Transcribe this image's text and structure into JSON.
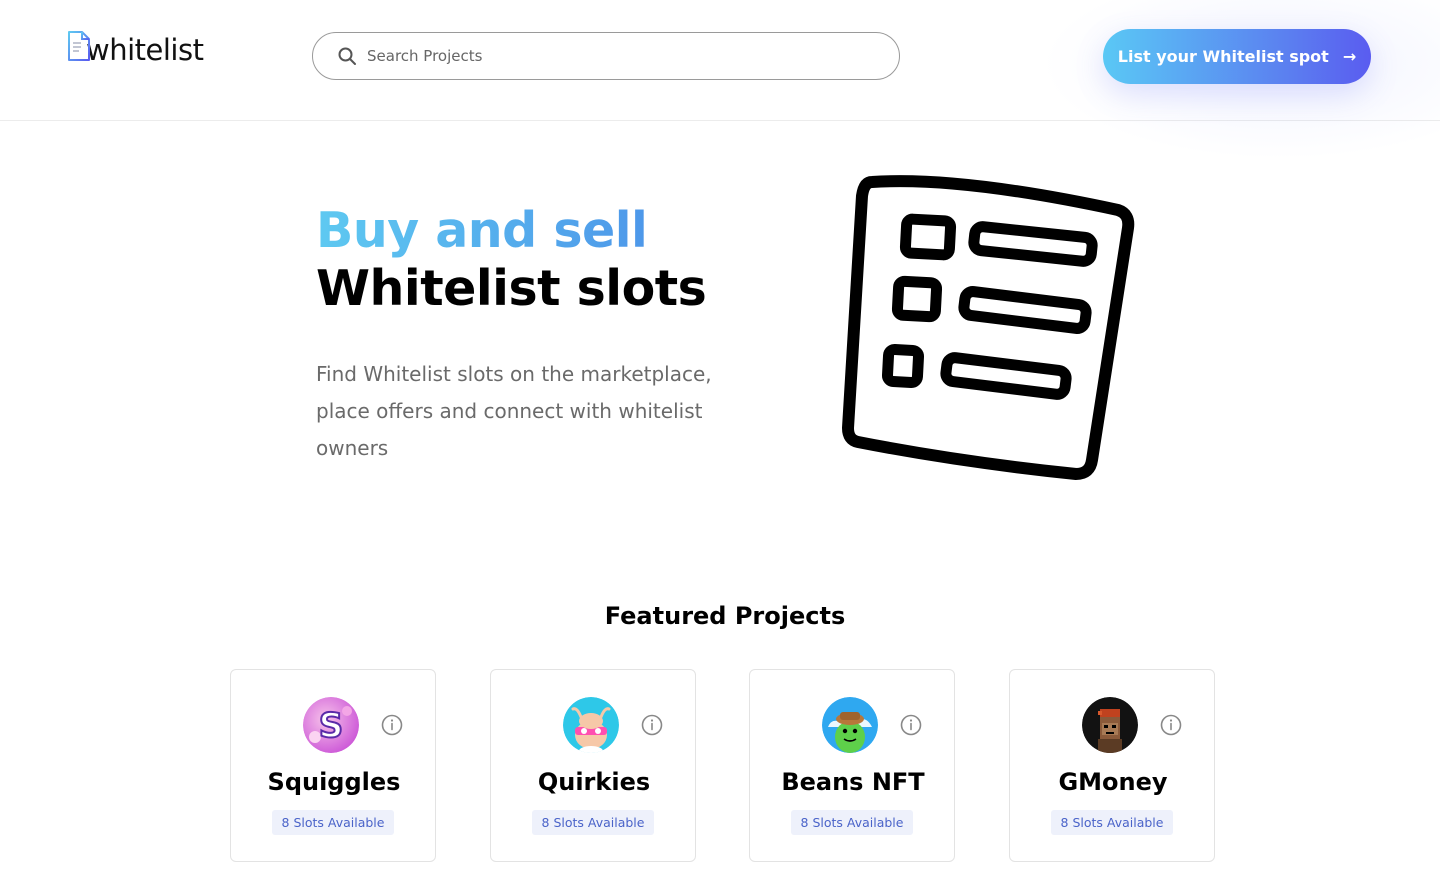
{
  "header": {
    "logo_text": "whitelist",
    "search_placeholder": "Search Projects",
    "cta_label": "List your Whitelist spot",
    "cta_arrow": "→"
  },
  "hero": {
    "title_line1": "Buy and sell",
    "title_line2": "Whitelist slots",
    "subtitle": "Find Whitelist slots on the marketplace, place offers and connect with whitelist owners"
  },
  "featured": {
    "title": "Featured Projects",
    "projects": [
      {
        "name": "Squiggles",
        "slots": "8 Slots Available",
        "avatar_icon": "squiggles-s-logo"
      },
      {
        "name": "Quirkies",
        "slots": "8 Slots Available",
        "avatar_icon": "quirkies-character"
      },
      {
        "name": "Beans NFT",
        "slots": "8 Slots Available",
        "avatar_icon": "beans-character"
      },
      {
        "name": "GMoney",
        "slots": "8 Slots Available",
        "avatar_icon": "pixel-ape"
      }
    ]
  },
  "colors": {
    "accent_gradient_start": "#5ac8f5",
    "accent_gradient_end": "#5a5cf0",
    "badge_bg": "#eef1fb",
    "badge_text": "#4a63c9"
  }
}
